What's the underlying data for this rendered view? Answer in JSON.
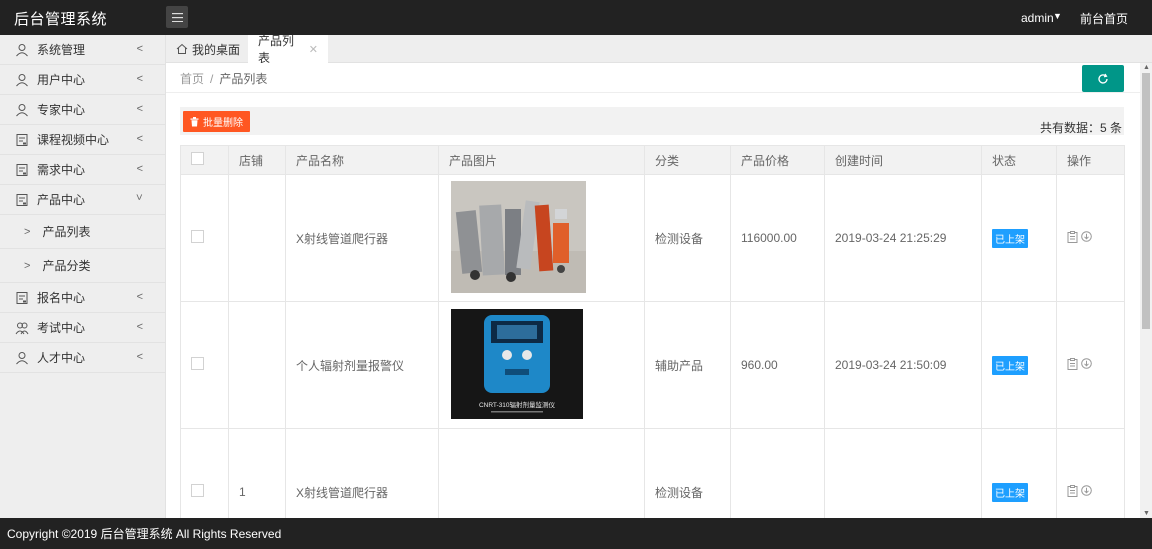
{
  "header": {
    "app_title": "后台管理系统",
    "user": "admin",
    "front_link": "前台首页"
  },
  "sidebar": {
    "items": [
      {
        "label": "系统管理",
        "icon": "user-icon"
      },
      {
        "label": "用户中心",
        "icon": "user-icon"
      },
      {
        "label": "专家中心",
        "icon": "user-icon"
      },
      {
        "label": "课程视频中心",
        "icon": "document-icon"
      },
      {
        "label": "需求中心",
        "icon": "document-icon"
      },
      {
        "label": "产品中心",
        "icon": "document-icon",
        "expanded": true
      },
      {
        "label": "报名中心",
        "icon": "document-icon"
      },
      {
        "label": "考试中心",
        "icon": "group-icon"
      },
      {
        "label": "人才中心",
        "icon": "user-icon"
      }
    ],
    "subitems": [
      {
        "label": "产品列表"
      },
      {
        "label": "产品分类"
      }
    ]
  },
  "tabs": {
    "home": "我的桌面",
    "active": "产品列表"
  },
  "breadcrumb": {
    "home": "首页",
    "sep": "/",
    "current": "产品列表"
  },
  "toolbar": {
    "batch_delete": "批量删除",
    "count_label": "共有数据：5 条"
  },
  "table": {
    "headers": [
      "",
      "店铺",
      "产品名称",
      "产品图片",
      "分类",
      "产品价格",
      "创建时间",
      "状态",
      "操作"
    ],
    "rows": [
      {
        "shop": "",
        "name": "X射线管道爬行器",
        "image": "pipeline-crawler-photo",
        "category": "检测设备",
        "price": "116000.00",
        "created": "2019-03-24 21:25:29",
        "status": "已上架"
      },
      {
        "shop": "",
        "name": "个人辐射剂量报警仪",
        "image": "radiation-alarm-photo",
        "image_caption": "CNRT-310辐射剂量监测仪",
        "category": "辅助产品",
        "price": "960.00",
        "created": "2019-03-24 21:50:09",
        "status": "已上架"
      },
      {
        "shop": "1",
        "name": "X射线管道爬行器",
        "image": "",
        "category": "检测设备",
        "price": "",
        "created": "",
        "status": "已上架"
      }
    ]
  },
  "footer": {
    "text": "Copyright ©2019 后台管理系统 All Rights Reserved"
  },
  "colors": {
    "header_bg": "#222222",
    "accent_teal": "#009688",
    "danger_orange": "#ff5722",
    "badge_blue": "#1e9fff"
  }
}
